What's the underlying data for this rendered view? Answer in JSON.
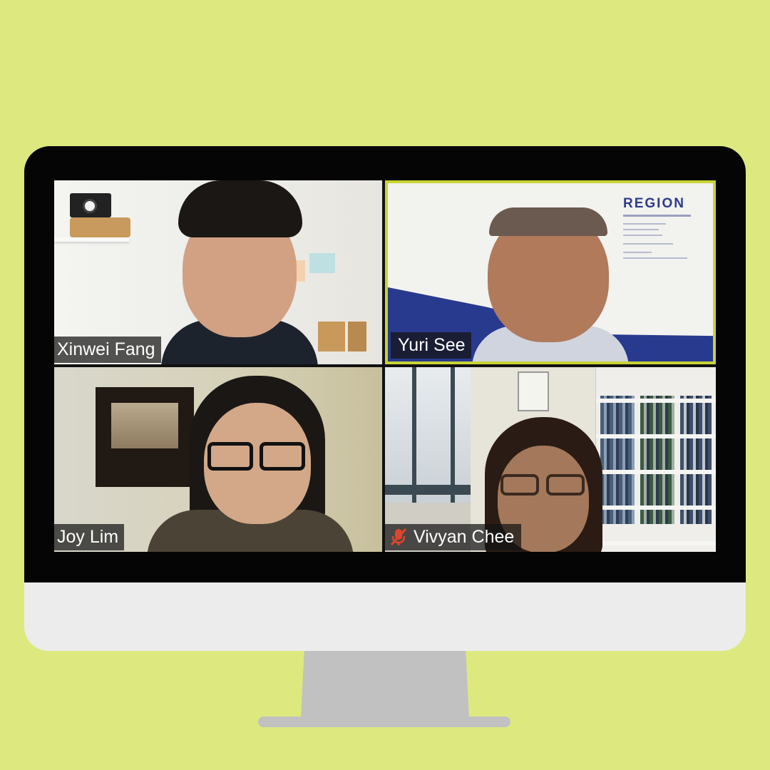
{
  "participants": [
    {
      "name": "Xinwei Fang",
      "muted": false,
      "active_speaker": false
    },
    {
      "name": "Yuri See",
      "muted": false,
      "active_speaker": true
    },
    {
      "name": "Joy Lim",
      "muted": false,
      "active_speaker": false
    },
    {
      "name": "Vivyan Chee",
      "muted": true,
      "active_speaker": false
    }
  ],
  "background": {
    "logo": "REGION"
  },
  "colors": {
    "page_bg": "#dde97e",
    "active_speaker_border": "#c9d236",
    "mute_icon": "#e0452b"
  },
  "icons": {
    "mute": "microphone-muted-icon"
  }
}
